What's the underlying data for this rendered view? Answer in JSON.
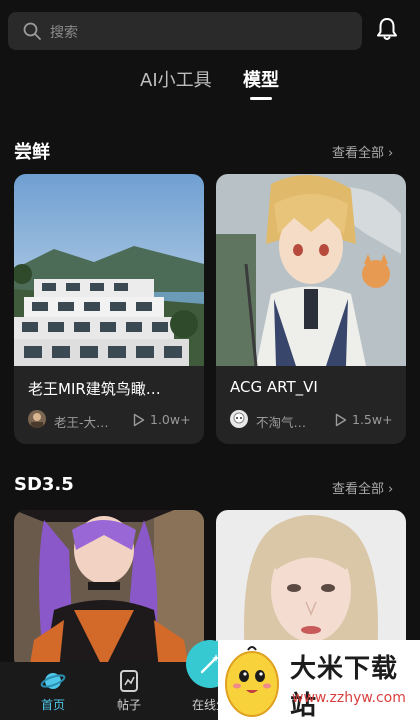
{
  "search": {
    "placeholder": "搜索"
  },
  "tabs": [
    {
      "label": "AI小工具"
    },
    {
      "label": "模型"
    }
  ],
  "sections": [
    {
      "title": "尝鲜",
      "view_all": "查看全部",
      "cards": [
        {
          "title": "老王MIR建筑鸟瞰…",
          "author": "老王-大…",
          "count": "1.0w+"
        },
        {
          "title": "ACG ART_VI",
          "author": "不淘气…",
          "count": "1.5w+"
        }
      ]
    },
    {
      "title": "SD3.5",
      "view_all": "查看全部",
      "cards": [
        {},
        {}
      ]
    }
  ],
  "bottom_nav": [
    {
      "label": "首页",
      "active": true
    },
    {
      "label": "帖子",
      "active": false
    },
    {
      "label": "在线生",
      "active": false
    }
  ],
  "watermark": {
    "title": "大米下载站",
    "url": "www.zzhyw.com"
  },
  "colors": {
    "background": "#111111",
    "card": "#242424",
    "accent": "#4fc7e8",
    "create_button": "#36c9d2"
  }
}
